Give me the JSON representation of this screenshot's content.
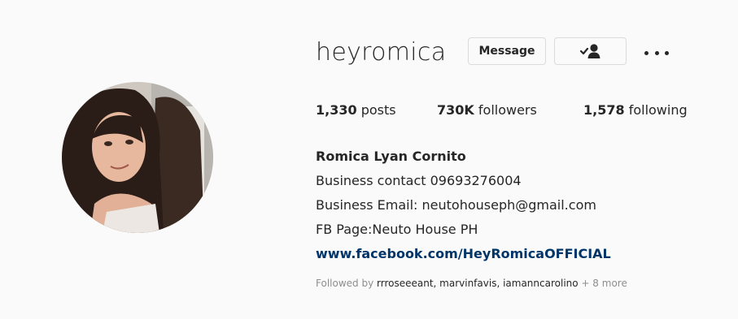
{
  "profile": {
    "username": "heyromica",
    "message_label": "Message",
    "following_icon": "person-check-icon",
    "more_icon": "more-options-icon"
  },
  "stats": {
    "posts_count": "1,330",
    "posts_label": "posts",
    "followers_count": "730K",
    "followers_label": "followers",
    "following_count": "1,578",
    "following_label": "following"
  },
  "bio": {
    "full_name": "Romica Lyan Cornito",
    "lines": [
      "Business contact 09693276004",
      "Business Email: neutohouseph@gmail.com",
      "FB Page:Neuto House PH"
    ],
    "link": "www.facebook.com/HeyRomicaOFFICIAL"
  },
  "followed_by": {
    "prefix": "Followed by",
    "names": "rrroseeeant, marvinfavis, iamanncarolino",
    "more": "+ 8 more"
  },
  "colors": {
    "background": "#fafafa",
    "text": "#262626",
    "link": "#003569",
    "muted": "#8e8e8e",
    "border": "#dbdbdb"
  }
}
